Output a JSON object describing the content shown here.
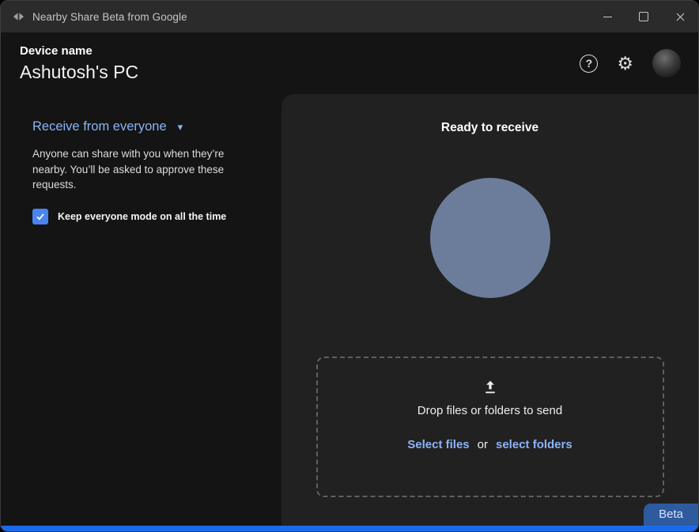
{
  "titlebar": {
    "title": "Nearby Share Beta from Google"
  },
  "icons": {
    "help": "?",
    "gear": "⚙",
    "caret_down": "▾"
  },
  "header": {
    "device_label": "Device name",
    "device_name": "Ashutosh's PC"
  },
  "left_panel": {
    "mode_selector": "Receive from everyone",
    "description": "Anyone can share with you when they’re nearby. You’ll be asked to approve these requests.",
    "checkbox_label": "Keep everyone mode on all the time",
    "checkbox_checked": true
  },
  "right_panel": {
    "status": "Ready to receive",
    "dropzone": {
      "title": "Drop files or folders to send",
      "select_files": "Select files",
      "or": "or",
      "select_folders": "select folders"
    }
  },
  "badge": {
    "label": "Beta"
  },
  "colors": {
    "accent_link": "#8ab4f8",
    "checkbox_blue": "#4a84ee",
    "receive_circle": "#6c7d9b",
    "bottom_accent": "#1a6bec",
    "beta_badge_bg": "#2d5b9e",
    "panel_bg": "#212121",
    "app_bg": "#141414",
    "titlebar_bg": "#2b2b2b"
  }
}
